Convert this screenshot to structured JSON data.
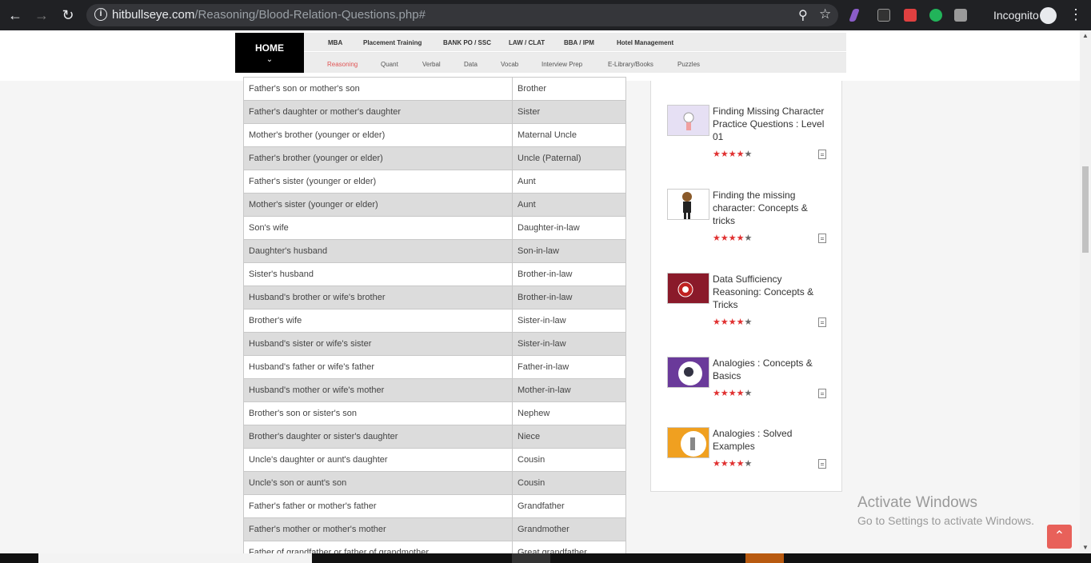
{
  "browser": {
    "url_domain": "hitbullseye.com",
    "url_path": "/Reasoning/Blood-Relation-Questions.php#",
    "profile_label": "Incognito"
  },
  "nav": {
    "home_label": "HOME",
    "top_links": [
      "MBA",
      "Placement Training",
      "BANK PO / SSC",
      "LAW / CLAT",
      "BBA / IPM",
      "Hotel Management"
    ],
    "sub_links": [
      "Reasoning",
      "Quant",
      "Verbal",
      "Data",
      "Vocab",
      "Interview Prep",
      "E-Library/Books",
      "Puzzles"
    ],
    "active_sub": "Reasoning"
  },
  "table": {
    "rows": [
      [
        "Father's son or mother's son",
        "Brother"
      ],
      [
        "Father's daughter or mother's daughter",
        "Sister"
      ],
      [
        "Mother's brother (younger or elder)",
        "Maternal Uncle"
      ],
      [
        "Father's brother (younger or elder)",
        "Uncle (Paternal)"
      ],
      [
        "Father's sister (younger or elder)",
        "Aunt"
      ],
      [
        "Mother's sister (younger or elder)",
        "Aunt"
      ],
      [
        "Son's wife",
        "Daughter-in-law"
      ],
      [
        "Daughter's husband",
        "Son-in-law"
      ],
      [
        "Sister's husband",
        "Brother-in-law"
      ],
      [
        "Husband's brother or wife's brother",
        "Brother-in-law"
      ],
      [
        "Brother's wife",
        "Sister-in-law"
      ],
      [
        "Husband's sister or wife's sister",
        "Sister-in-law"
      ],
      [
        "Husband's father or wife's father",
        "Father-in-law"
      ],
      [
        "Husband's mother or wife's mother",
        "Mother-in-law"
      ],
      [
        "Brother's son or sister's son",
        "Nephew"
      ],
      [
        "Brother's daughter or sister's daughter",
        "Niece"
      ],
      [
        "Uncle's daughter or aunt's daughter",
        "Cousin"
      ],
      [
        "Uncle's son or aunt's son",
        "Cousin"
      ],
      [
        "Father's father or mother's father",
        "Grandfather"
      ],
      [
        "Father's mother or mother's mother",
        "Grandmother"
      ],
      [
        "Father of grandfather or father of grandmother",
        "Great grandfather"
      ]
    ]
  },
  "sidebar": {
    "cards": [
      {
        "title": "Finding Missing Character Practice Questions : Level 01",
        "rating": 4
      },
      {
        "title": "Finding the missing character: Concepts & tricks",
        "rating": 4
      },
      {
        "title": "Data Sufficiency Reasoning: Concepts & Tricks",
        "rating": 4
      },
      {
        "title": "Analogies : Concepts & Basics",
        "rating": 4
      },
      {
        "title": "Analogies : Solved Examples",
        "rating": 4
      }
    ]
  },
  "watermark": {
    "line1": "Activate Windows",
    "line2": "Go to Settings to activate Windows."
  },
  "colors": {
    "accent": "#e05555",
    "star_on": "#e03030",
    "star_off": "#666666"
  }
}
